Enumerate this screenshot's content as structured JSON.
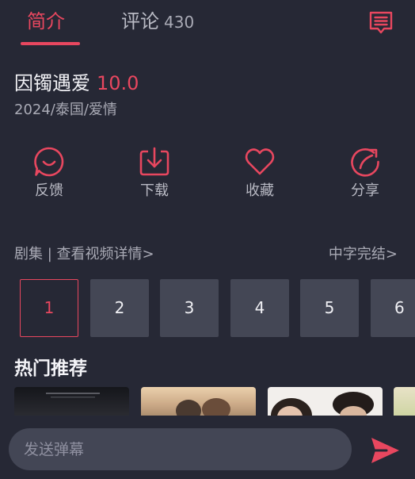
{
  "tabs": {
    "intro_label": "简介",
    "comments_label": "评论",
    "comments_count": "430"
  },
  "video": {
    "title": "因镯遇爱",
    "score": "10.0",
    "meta": "2024/泰国/爱情"
  },
  "actions": [
    {
      "label": "反馈",
      "icon": "feedback-icon"
    },
    {
      "label": "下载",
      "icon": "download-icon"
    },
    {
      "label": "收藏",
      "icon": "heart-icon"
    },
    {
      "label": "分享",
      "icon": "share-icon"
    }
  ],
  "episodes_header": {
    "left": "剧集 | 查看视频详情>",
    "right": "中字完结>"
  },
  "episodes": [
    "1",
    "2",
    "3",
    "4",
    "5",
    "6"
  ],
  "selected_episode": "1",
  "hot": {
    "title": "热门推荐"
  },
  "bottom": {
    "input_placeholder": "发送弹幕"
  },
  "colors": {
    "accent": "#e8475f",
    "background": "#262835",
    "tile": "#444755"
  }
}
